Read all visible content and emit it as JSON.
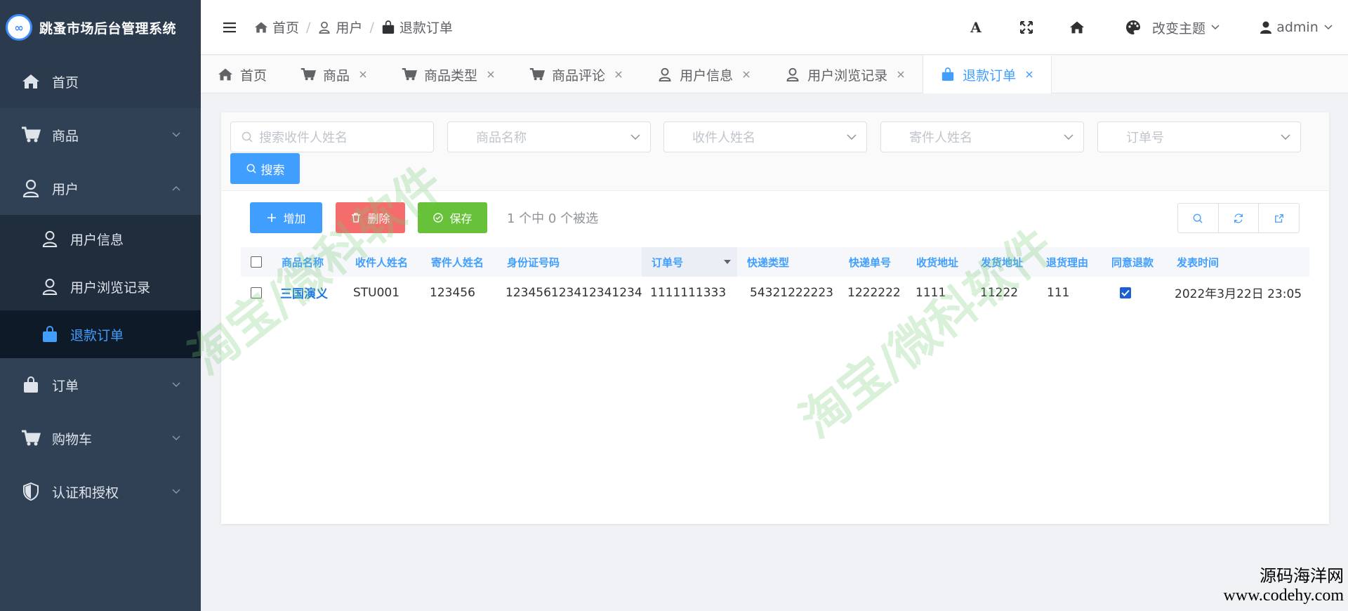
{
  "app": {
    "title": "跳蚤市场后台管理系统",
    "logo_mark": "∞"
  },
  "sidebar": {
    "items": [
      {
        "label": "首页"
      },
      {
        "label": "商品"
      },
      {
        "label": "用户"
      },
      {
        "label": "订单"
      },
      {
        "label": "购物车"
      },
      {
        "label": "认证和授权"
      }
    ],
    "user_sub": [
      {
        "label": "用户信息"
      },
      {
        "label": "用户浏览记录"
      },
      {
        "label": "退款订单"
      }
    ]
  },
  "breadcrumb": [
    {
      "label": "首页"
    },
    {
      "label": "用户"
    },
    {
      "label": "退款订单"
    }
  ],
  "header": {
    "theme_label": "改变主题",
    "user_label": "admin",
    "font_icon_label": "A"
  },
  "tabs": [
    {
      "label": "首页"
    },
    {
      "label": "商品"
    },
    {
      "label": "商品类型"
    },
    {
      "label": "商品评论"
    },
    {
      "label": "用户信息"
    },
    {
      "label": "用户浏览记录"
    },
    {
      "label": "退款订单"
    }
  ],
  "filters": {
    "receiver_search_placeholder": "搜索收件人姓名",
    "product_placeholder": "商品名称",
    "receiver_placeholder": "收件人姓名",
    "sender_placeholder": "寄件人姓名",
    "order_placeholder": "订单号",
    "search_label": "搜索"
  },
  "toolbar": {
    "add_label": "增加",
    "delete_label": "删除",
    "save_label": "保存",
    "selection_info": "1 个中 0 个被选"
  },
  "table": {
    "columns": [
      "商品名称",
      "收件人姓名",
      "寄件人姓名",
      "身份证号码",
      "订单号",
      "快递类型",
      "快递单号",
      "收货地址",
      "发货地址",
      "退货理由",
      "同意退款",
      "发表时间"
    ],
    "rows": [
      [
        "三国演义",
        "STU001",
        "123456",
        "123456123412341234",
        "1111111333",
        "54321222223",
        "1222222",
        "1111",
        "11222",
        "111",
        "",
        "2022年3月22日 23:05"
      ]
    ]
  },
  "watermark": "淘宝/微科软件",
  "footer": {
    "line1": "源码海洋网",
    "line2": "www.codehy.com"
  },
  "colors": {
    "sidebar": "#304156",
    "primary": "#409eff",
    "danger": "#f56c6c",
    "success": "#67c23a"
  }
}
